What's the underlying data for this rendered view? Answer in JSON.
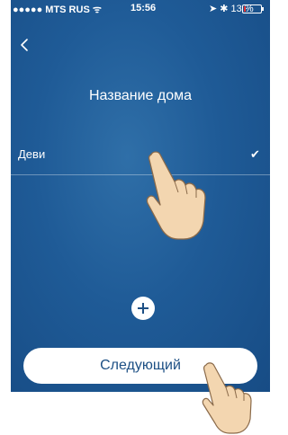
{
  "status_bar": {
    "signal": "●●●●● MTS RUS ᯤ",
    "time": "15:56",
    "battery_text": "➤ ✱ 13 %",
    "battery_level": 0.13,
    "battery_color": "#e23030"
  },
  "nav": {
    "back_icon": "chevron-left-icon"
  },
  "title": "Название дома",
  "homes": [
    {
      "name": "Деви",
      "selected": true
    }
  ],
  "add_icon": "plus-icon",
  "next_button": "Следующий",
  "colors": {
    "background_top": "#2f6fa8",
    "background_bottom": "#174c85",
    "button_text": "#1c4f84"
  }
}
